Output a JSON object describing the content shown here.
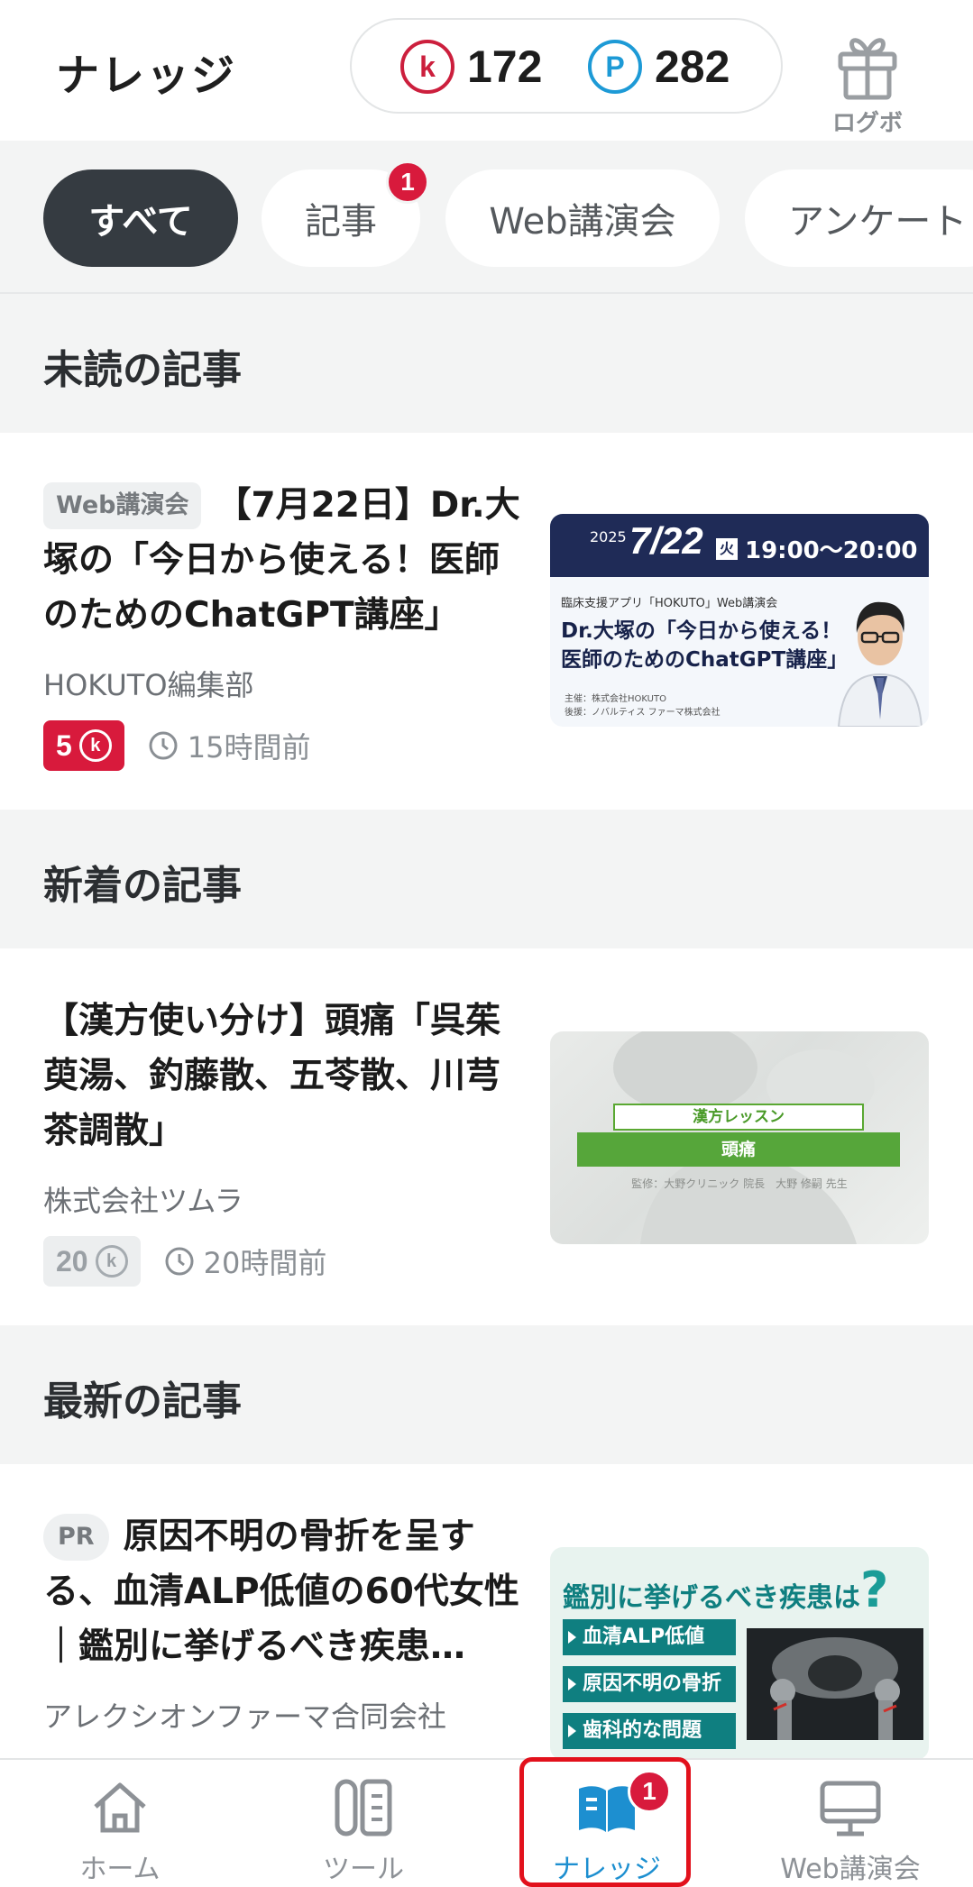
{
  "header": {
    "title": "ナレッジ",
    "k_points": "172",
    "k_symbol": "k",
    "p_points": "282",
    "p_symbol": "P",
    "gift_label": "ログボ"
  },
  "tabs": [
    {
      "label": "すべて",
      "active": true
    },
    {
      "label": "記事",
      "badge": "1"
    },
    {
      "label": "Web講演会"
    },
    {
      "label": "アンケート"
    }
  ],
  "sections": [
    {
      "title": "未読の記事",
      "article": {
        "tag": "Web講演会",
        "headline": "【7月22日】Dr.大塚の「今日から使える！医師のためのChatGPT講座」",
        "publisher": "HOKUTO編集部",
        "points": "5",
        "time": "15時間前",
        "thumb": {
          "year": "2025",
          "date": "7/22",
          "weekday": "火",
          "time": "19:00〜20:00",
          "subtitle": "臨床支援アプリ「HOKUTO」Web講演会",
          "title_line1": "Dr.大塚の「今日から使える！",
          "title_line2": "医師のためのChatGPT講座」",
          "foot1": "主催：株式会社HOKUTO",
          "foot2": "後援：ノバルティス ファーマ株式会社"
        }
      }
    },
    {
      "title": "新着の記事",
      "article": {
        "headline": "【漢方使い分け】頭痛「呉茱萸湯、釣藤散、五苓散、川芎茶調散」",
        "publisher": "株式会社ツムラ",
        "points": "20",
        "time": "20時間前",
        "thumb": {
          "label1": "漢方レッスン",
          "label2": "頭痛",
          "caption": "監修：大野クリニック 院長　大野 修嗣 先生"
        }
      }
    },
    {
      "title": "最新の記事",
      "article": {
        "tag": "PR",
        "headline": "原因不明の骨折を呈する、血清ALP低値の60代女性｜鑑別に挙げるべき疾患…",
        "publisher": "アレクシオンファーマ合同会社",
        "thumb": {
          "question": "鑑別に挙げるべき疾患は",
          "question_mark": "?",
          "items": [
            "血清ALP低値",
            "原因不明の骨折",
            "歯科的な問題"
          ]
        }
      }
    }
  ],
  "bottom_nav": [
    {
      "label": "ホーム",
      "icon": "home-icon"
    },
    {
      "label": "ツール",
      "icon": "tools-icon"
    },
    {
      "label": "ナレッジ",
      "icon": "book-icon",
      "active": true,
      "badge": "1"
    },
    {
      "label": "Web講演会",
      "icon": "monitor-icon"
    }
  ],
  "colors": {
    "accent_red": "#d81a3c",
    "accent_blue": "#1d8fd0",
    "active_chip": "#353b41"
  }
}
